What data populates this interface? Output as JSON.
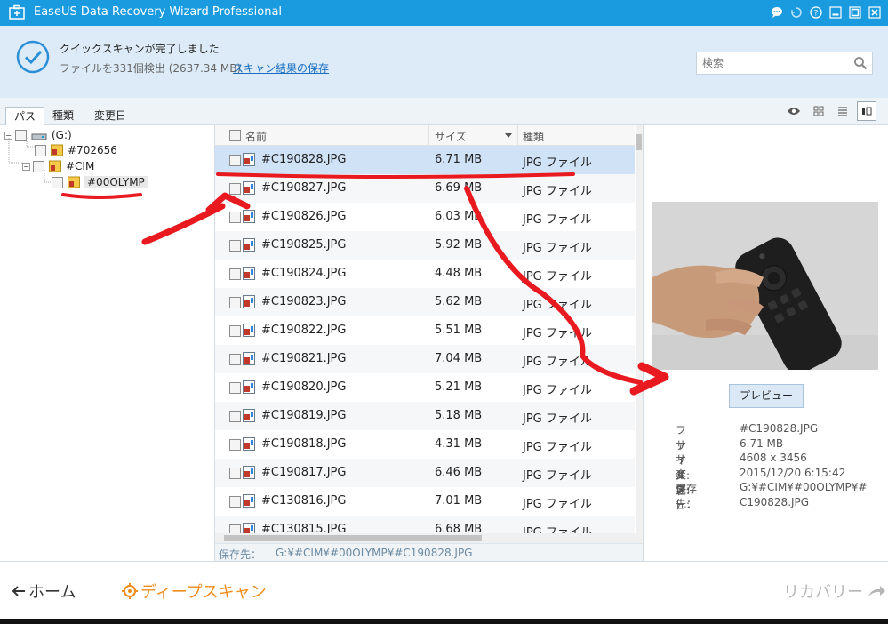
{
  "window": {
    "title": "EaseUS Data Recovery Wizard Professional",
    "icons": [
      "app-icon",
      "chat-icon",
      "restore-icon",
      "help-icon",
      "minimize-icon",
      "maximize-icon",
      "close-icon"
    ]
  },
  "header": {
    "status_title": "クイックスキャンが完了しました",
    "status_detail": "ファイルを331個検出 (2637.34 MB)",
    "save_link": "スキャン結果の保存",
    "search_placeholder": "検索"
  },
  "tabs": [
    "パス",
    "種類",
    "変更日"
  ],
  "tree": {
    "drive": "(G:)",
    "nodes": [
      "#702656_",
      "#CIM",
      "#00OLYMP"
    ]
  },
  "list": {
    "columns": {
      "name": "名前",
      "size": "サイズ",
      "type": "種類"
    },
    "rows": [
      {
        "name": "#C190828.JPG",
        "size": "6.71 MB",
        "type": "JPG ファイル"
      },
      {
        "name": "#C190827.JPG",
        "size": "6.69 MB",
        "type": "JPG ファイル"
      },
      {
        "name": "#C190826.JPG",
        "size": "6.03 MB",
        "type": "JPG ファイル"
      },
      {
        "name": "#C190825.JPG",
        "size": "5.92 MB",
        "type": "JPG ファイル"
      },
      {
        "name": "#C190824.JPG",
        "size": "4.48 MB",
        "type": "JPG ファイル"
      },
      {
        "name": "#C190823.JPG",
        "size": "5.62 MB",
        "type": "JPG ファイル"
      },
      {
        "name": "#C190822.JPG",
        "size": "5.51 MB",
        "type": "JPG ファイル"
      },
      {
        "name": "#C190821.JPG",
        "size": "7.04 MB",
        "type": "JPG ファイル"
      },
      {
        "name": "#C190820.JPG",
        "size": "5.21 MB",
        "type": "JPG ファイル"
      },
      {
        "name": "#C190819.JPG",
        "size": "5.18 MB",
        "type": "JPG ファイル"
      },
      {
        "name": "#C190818.JPG",
        "size": "4.31 MB",
        "type": "JPG ファイル"
      },
      {
        "name": "#C190817.JPG",
        "size": "6.46 MB",
        "type": "JPG ファイル"
      },
      {
        "name": "#C130816.JPG",
        "size": "7.01 MB",
        "type": "JPG ファイル"
      },
      {
        "name": "#C130815.JPG",
        "size": "6.68 MB",
        "type": "JPG ファイル"
      }
    ],
    "selected_index": 0
  },
  "pathbar": {
    "label": "保存先：",
    "value": "G:¥#CIM¥#00OLYMP¥#C190828.JPG"
  },
  "preview": {
    "button": "プレビュー",
    "meta": [
      {
        "key": "ファイル名:",
        "value": "#C190828.JPG"
      },
      {
        "key": "サイズ:",
        "value": "6.71 MB"
      },
      {
        "key": "サイズ:",
        "value": "4608 x 3456"
      },
      {
        "key": "変更日:",
        "value": "2015/12/20 6:15:42"
      },
      {
        "key": "保存先：",
        "value": "G:¥#CIM¥#00OLYMP¥#"
      },
      {
        "key": "",
        "value": "C190828.JPG"
      }
    ]
  },
  "footer": {
    "home": "ホーム",
    "deep_scan": "ディープスキャン",
    "recover": "リカバリー"
  },
  "colors": {
    "titlebar": "#1a9be0",
    "header_bg": "#dcebf7",
    "selected_row": "#cfe2f6",
    "deep_scan": "#f08c1b",
    "annotation": "#e8191f"
  }
}
